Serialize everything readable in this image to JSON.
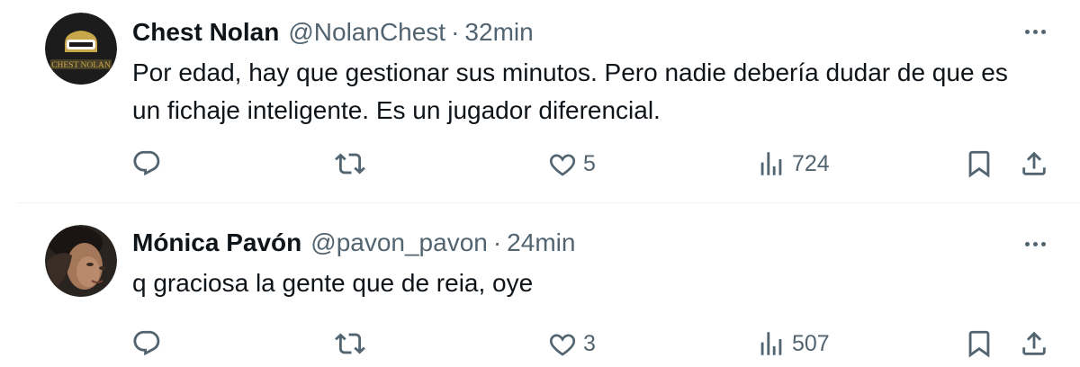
{
  "tweets": [
    {
      "author_name": "Chest Nolan",
      "handle": "@NolanChest",
      "separator": "·",
      "time": "32min",
      "avatar_text": "CHEST NOLAN",
      "text": "Por edad, hay que gestionar sus minutos. Pero nadie debería dudar de que es un fichaje inteligente. Es un jugador diferencial.",
      "likes": "5",
      "views": "724"
    },
    {
      "author_name": "Mónica Pavón",
      "handle": "@pavon_pavon",
      "separator": "·",
      "time": "24min",
      "text": "q graciosa la gente que de reia, oye",
      "likes": "3",
      "views": "507"
    }
  ],
  "icons": {
    "reply": "reply-icon",
    "retweet": "retweet-icon",
    "like": "heart-icon",
    "views": "views-icon",
    "bookmark": "bookmark-icon",
    "share": "share-icon",
    "more": "more-icon"
  },
  "colors": {
    "text": "#0f1419",
    "secondary": "#536471",
    "divider": "#eff3f4",
    "avatar1_bg": "#1c1c1c",
    "avatar1_accent": "#c8a64a"
  }
}
